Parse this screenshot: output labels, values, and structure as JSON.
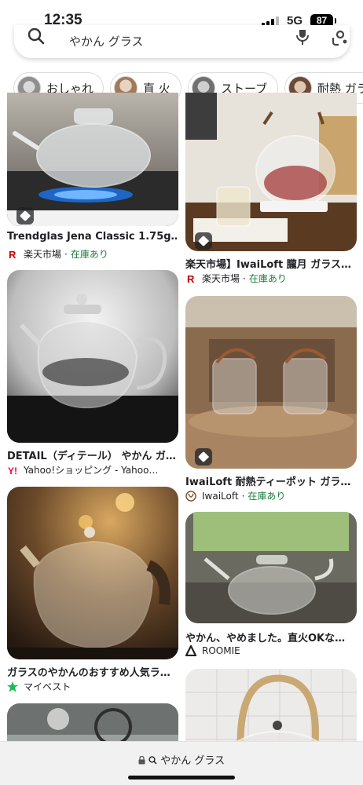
{
  "status": {
    "time": "12:35",
    "network": "5G",
    "battery": "87"
  },
  "search": {
    "query": "やかん グラス"
  },
  "chips": [
    {
      "label": "おしゃれ"
    },
    {
      "label": "直 火"
    },
    {
      "label": "ストーブ"
    },
    {
      "label": "耐熱 ガラス"
    }
  ],
  "results": {
    "r1": {
      "title": "Trendglas Jena Classic 1.75g…",
      "source": "楽天市場",
      "stock": "在庫あり"
    },
    "r2": {
      "title": "楽天市場】IwaiLoft 朧月 ガラス…",
      "source": "楽天市場",
      "stock": "在庫あり"
    },
    "r3": {
      "title": "DETAIL（ディテール） やかん ガ…",
      "source": "Yahoo!ショッピング - Yahoo…"
    },
    "r4": {
      "title": "IwaiLoft 耐熱ティーポット ガラ…",
      "source": "IwaiLoft",
      "stock": "在庫あり"
    },
    "r5": {
      "title": "ガラスのやかんのおすすめ人気ラ…",
      "source": "マイベスト"
    },
    "r6": {
      "title": "やかん、やめました。直火OKな…",
      "source": "ROOMIE"
    }
  },
  "separator": "·",
  "bottom": {
    "url": "やかん グラス"
  },
  "colors": {
    "rakuten": "#bf0000",
    "yahoo": "#ff0033",
    "stock": "#188038",
    "mybest": "#1db954"
  }
}
